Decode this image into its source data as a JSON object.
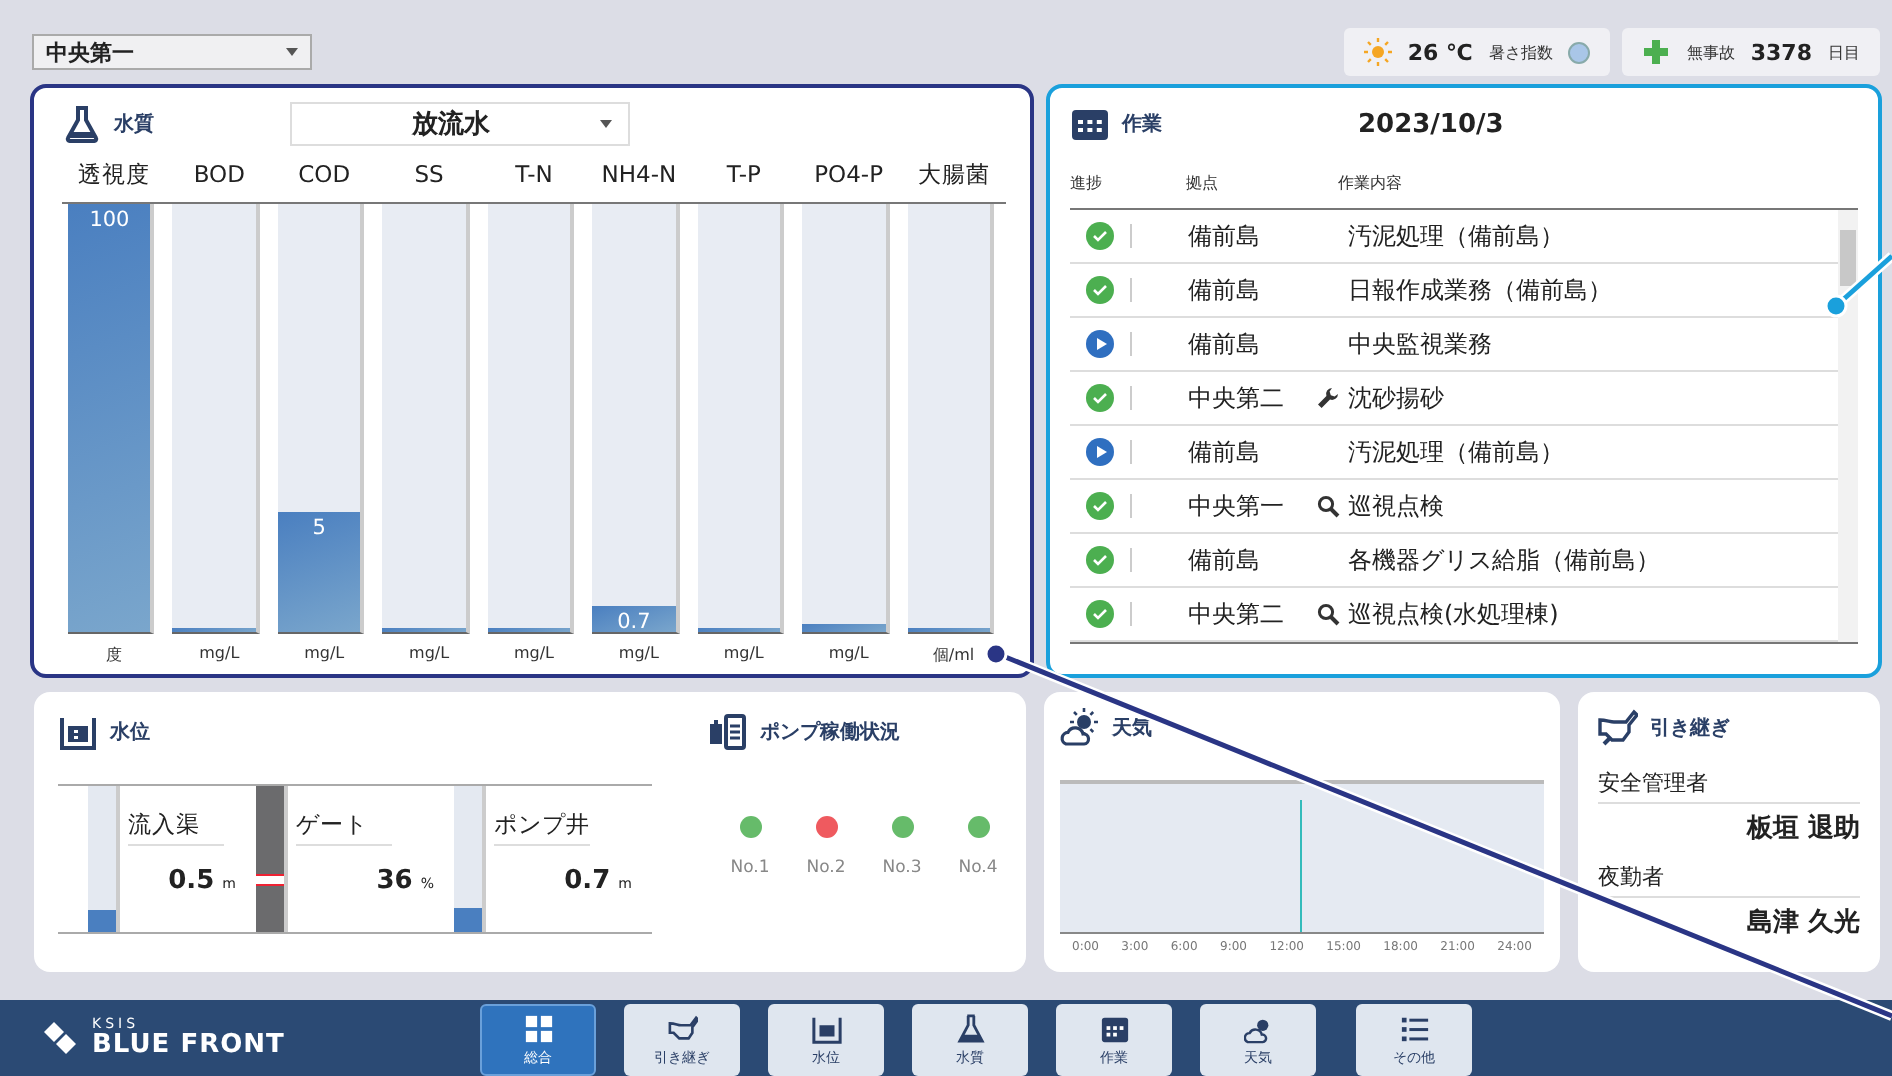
{
  "top_bar": {
    "site_select": "中央第一",
    "temperature": "26 ℃",
    "heat_index": {
      "label": "暑さ指数",
      "color": "#a9c6e8"
    },
    "safety_label": "無事故",
    "safety_days": "3378",
    "days_unit": "日目"
  },
  "water_quality": {
    "title": "水質",
    "sample_select": "放流水",
    "items": [
      {
        "name": "透視度",
        "unit": "度",
        "level": 1.0,
        "reading": "100"
      },
      {
        "name": "BOD",
        "unit": "mg/L",
        "level": 0
      },
      {
        "name": "COD",
        "unit": "mg/L",
        "level": 0.28,
        "reading": "5"
      },
      {
        "name": "SS",
        "unit": "mg/L",
        "level": 0
      },
      {
        "name": "T-N",
        "unit": "mg/L",
        "level": 0
      },
      {
        "name": "NH4-N",
        "unit": "mg/L",
        "level": 0.06,
        "reading": "0.7"
      },
      {
        "name": "T-P",
        "unit": "mg/L",
        "level": 0
      },
      {
        "name": "PO4-P",
        "unit": "mg/L",
        "level": 0.02
      },
      {
        "name": "大腸菌",
        "unit": "個/ml",
        "level": 0
      }
    ]
  },
  "work": {
    "title": "作業",
    "date": "2023/10/3",
    "columns": [
      "進捗",
      "拠点",
      "作業内容"
    ],
    "rows": [
      {
        "completed": true,
        "site": "備前島",
        "kind": "none",
        "task": "汚泥処理（備前島）"
      },
      {
        "completed": true,
        "site": "備前島",
        "kind": "none",
        "task": "日報作成業務（備前島）"
      },
      {
        "completed": false,
        "site": "備前島",
        "kind": "none",
        "task": "中央監視業務"
      },
      {
        "completed": true,
        "site": "中央第二",
        "kind": "repair",
        "task": "沈砂揚砂"
      },
      {
        "completed": false,
        "site": "備前島",
        "kind": "none",
        "task": "汚泥処理（備前島）"
      },
      {
        "completed": true,
        "site": "中央第一",
        "kind": "inspection",
        "task": "巡視点検"
      },
      {
        "completed": true,
        "site": "備前島",
        "kind": "none",
        "task": "各機器グリス給脂（備前島）"
      },
      {
        "completed": true,
        "site": "中央第二",
        "kind": "inspection",
        "task": "巡視点検(水処理棟)"
      }
    ]
  },
  "water_level": {
    "title": "水位",
    "gauges": [
      {
        "kind": "tank",
        "name": "流入渠",
        "value": "0.5",
        "unit": "m",
        "level": 0.15
      },
      {
        "kind": "gate",
        "name": "ゲート",
        "value": "36",
        "unit": "%",
        "level": 0.36
      },
      {
        "kind": "tank",
        "name": "ポンプ井",
        "value": "0.7",
        "unit": "m",
        "level": 0.17
      }
    ]
  },
  "pumps": {
    "title": "ポンプ稼働状況",
    "items": [
      {
        "label": "No.1",
        "color": "#66bb6a"
      },
      {
        "label": "No.2",
        "color": "#ef5a5f"
      },
      {
        "label": "No.3",
        "color": "#66bb6a"
      },
      {
        "label": "No.4",
        "color": "#66bb6a"
      }
    ]
  },
  "weather": {
    "title": "天気",
    "time_labels": [
      "0:00",
      "3:00",
      "6:00",
      "9:00",
      "12:00",
      "15:00",
      "18:00",
      "21:00",
      "24:00"
    ]
  },
  "handover": {
    "title": "引き継ぎ",
    "entries": [
      {
        "role": "安全管理者",
        "name": "板垣 退助"
      },
      {
        "role": "夜勤者",
        "name": "島津 久光"
      }
    ]
  },
  "nav": {
    "brand_small": "KSIS",
    "brand": "BLUE FRONT",
    "items": [
      {
        "kind": "overview",
        "label": "総合",
        "selected": true
      },
      {
        "kind": "handover",
        "label": "引き継ぎ",
        "selected": false
      },
      {
        "kind": "level",
        "label": "水位",
        "selected": false
      },
      {
        "kind": "quality",
        "label": "水質",
        "selected": false
      },
      {
        "kind": "work",
        "label": "作業",
        "selected": false
      },
      {
        "kind": "weather",
        "label": "天気",
        "selected": false
      },
      {
        "kind": "other",
        "label": "その他",
        "selected": false
      }
    ]
  }
}
